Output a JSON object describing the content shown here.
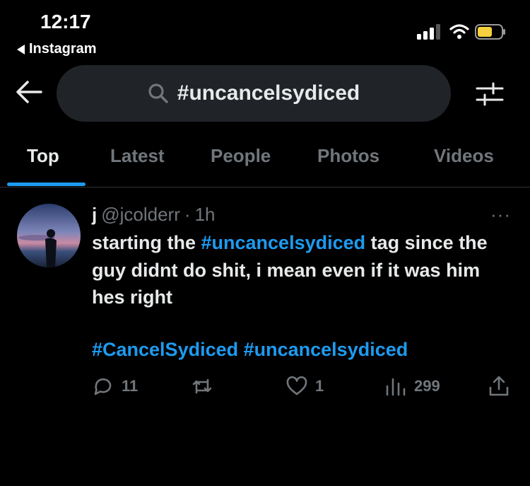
{
  "status_bar": {
    "time": "12:17",
    "back_app": "Instagram"
  },
  "search": {
    "query": "#uncancelsydiced"
  },
  "tabs": [
    {
      "label": "Top",
      "active": true
    },
    {
      "label": "Latest",
      "active": false
    },
    {
      "label": "People",
      "active": false
    },
    {
      "label": "Photos",
      "active": false
    },
    {
      "label": "Videos",
      "active": false
    }
  ],
  "tweet": {
    "name": "j",
    "handle": "@jcolderr",
    "separator": "·",
    "time": "1h",
    "more": "···",
    "text_before": "starting the ",
    "text_tag": "#uncancelsydiced",
    "text_after": " tag since the guy didnt do shit, i mean even if it was him hes right",
    "tag_1": "#CancelSydiced",
    "tag_2": "#uncancelsydiced",
    "replies": "11",
    "likes": "1",
    "views": "299"
  },
  "colors": {
    "accent": "#1d9bf0",
    "muted": "#71767b",
    "background": "#000000",
    "pill": "#202327"
  },
  "icons": [
    "back-arrow-icon",
    "search-icon",
    "filter-icon",
    "reply-icon",
    "retweet-icon",
    "like-icon",
    "views-icon",
    "share-icon",
    "more-icon"
  ]
}
